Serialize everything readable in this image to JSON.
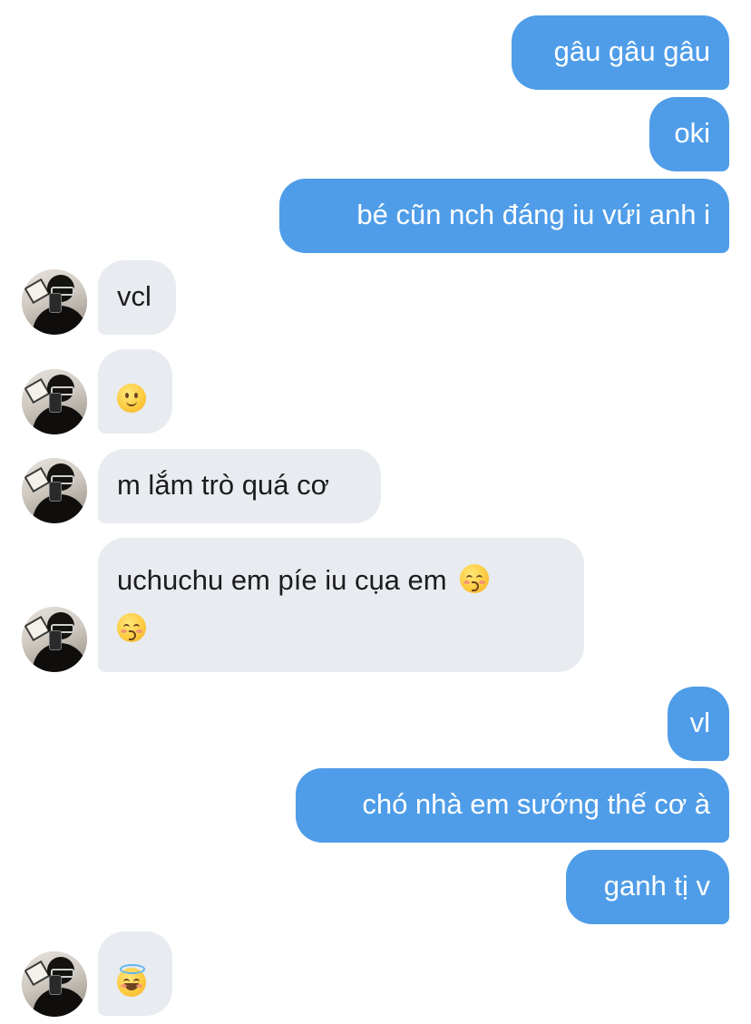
{
  "messages": [
    {
      "id": "m1",
      "dir": "out",
      "text": "gâu gâu gâu"
    },
    {
      "id": "m2",
      "dir": "out",
      "text": "oki"
    },
    {
      "id": "m3",
      "dir": "out",
      "text": "bé cũn nch đáng iu vứi anh i"
    },
    {
      "id": "m4",
      "dir": "in",
      "text": "vcl"
    },
    {
      "id": "m5",
      "dir": "in",
      "emoji": "slightly-smiling-face"
    },
    {
      "id": "m6",
      "dir": "in",
      "text": "m lắm trò quá cơ"
    },
    {
      "id": "m7",
      "dir": "in",
      "text": "uchuchu em píe iu cụa em",
      "emoji": "kissing-face-with-closed-eyes"
    },
    {
      "id": "m8",
      "dir": "out",
      "text": "vl"
    },
    {
      "id": "m9",
      "dir": "out",
      "text": "chó nhà em sướng thế cơ à"
    },
    {
      "id": "m10",
      "dir": "out",
      "text": "ganh tị v"
    },
    {
      "id": "m11",
      "dir": "in",
      "emoji": "smiling-face-with-halo"
    }
  ],
  "colors": {
    "outgoing_bubble": "#4f9de8",
    "incoming_bubble": "#e8ebef",
    "outgoing_text": "#ffffff",
    "incoming_text": "#1c1c1e",
    "background": "#ffffff"
  }
}
